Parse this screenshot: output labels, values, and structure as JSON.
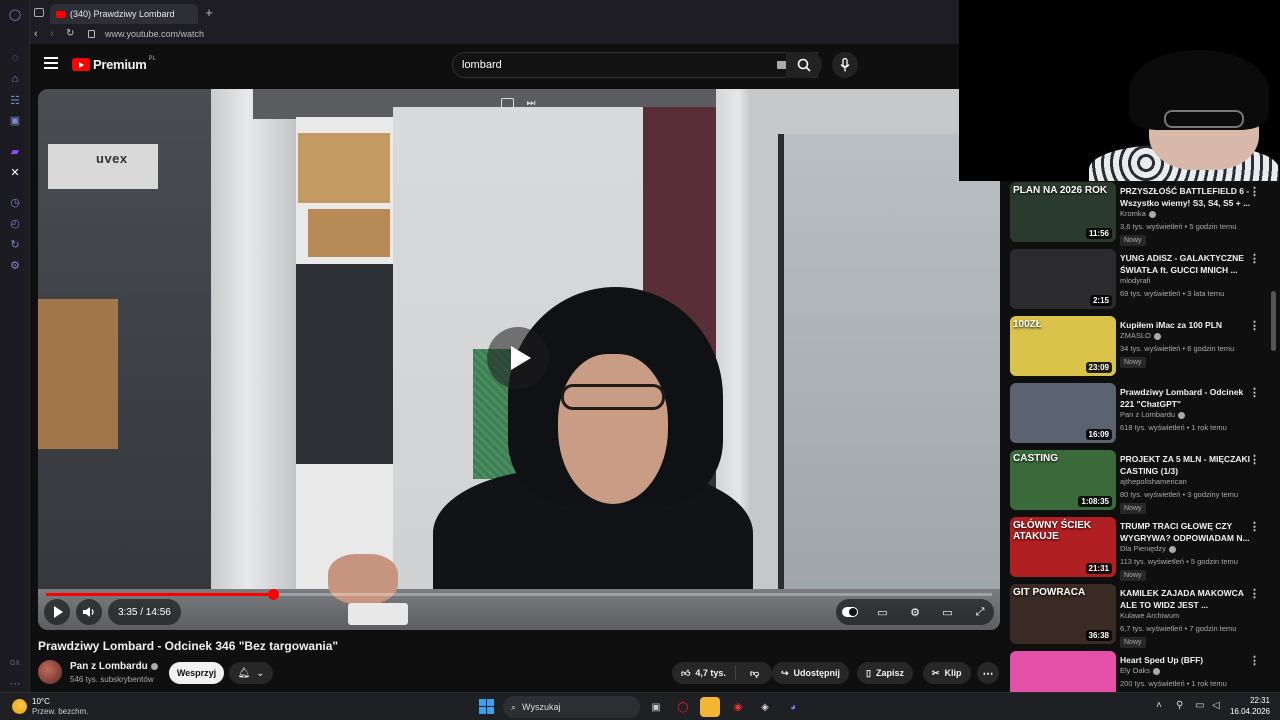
{
  "browser": {
    "tab_title": "(340) Prawdziwy Lombard",
    "new_tab": "+",
    "url": "www.youtube.com/watch"
  },
  "yt_header": {
    "logo_text": "Premium",
    "logo_region": "PL",
    "search_query": "lombard"
  },
  "player": {
    "time": "3:35 / 14:56",
    "progress_fraction": 0.24,
    "scene_text": "uvex"
  },
  "video": {
    "title": "Prawdziwy Lombard - Odcinek 346 \"Bez targowania\"",
    "channel": "Pan z Lombardu",
    "subscribers": "546 tys. subskrybentów",
    "support_label": "Wesprzyj",
    "likes": "4,7 tys.",
    "share_label": "Udostępnij",
    "save_label": "Zapisz",
    "clip_label": "Klip",
    "more_label": "⋯"
  },
  "recommendations": [
    {
      "title": "PRZYSZŁOŚĆ BATTLEFIELD 6 - Wszystko wiemy! S3, S4, S5 + ...",
      "channel": "Kromka",
      "verified": true,
      "meta": "3,6 tys. wyświetleń • 5 godzin temu",
      "duration": "11:56",
      "badge": "Nowy",
      "thumb_text": "PLAN NA 2026 ROK",
      "thumb_color": "#2a3a2c"
    },
    {
      "title": "YUNG ADISZ - GALAKTYCZNE ŚWIATŁA ft. GUCCI MNICH ...",
      "channel": "mlodyrafi",
      "verified": false,
      "meta": "69 tys. wyświetleń • 3 lata temu",
      "duration": "2:15",
      "badge": "",
      "thumb_text": "",
      "thumb_color": "#2b2b2d"
    },
    {
      "title": "Kupiłem iMac za 100 PLN",
      "channel": "ZMASLO",
      "verified": true,
      "meta": "34 tys. wyświetleń • 6 godzin temu",
      "duration": "23:09",
      "badge": "Nowy",
      "thumb_text": "100ZŁ",
      "thumb_color": "#d9c34a"
    },
    {
      "title": "Prawdziwy Lombard - Odcinek 221 \"ChatGPT\"",
      "channel": "Pan z Lombardu",
      "verified": true,
      "meta": "618 tys. wyświetleń • 1 rok temu",
      "duration": "16:09",
      "badge": "",
      "thumb_text": "",
      "thumb_color": "#5a6470"
    },
    {
      "title": "PROJEKT ZA 5 MLN - MIĘCZAKI CASTING (1/3)",
      "channel": "ajthepolishamerican",
      "verified": false,
      "meta": "80 tys. wyświetleń • 3 godziny temu",
      "duration": "1:08:35",
      "badge": "Nowy",
      "thumb_text": "CASTING",
      "thumb_color": "#3b6a3a"
    },
    {
      "title": "TRUMP TRACI GŁOWĘ CZY WYGRYWA? ODPOWIADAM N...",
      "channel": "Dla Pieniędzy",
      "verified": true,
      "meta": "113 tys. wyświetleń • 5 godzin temu",
      "duration": "21:31",
      "badge": "Nowy",
      "thumb_text": "GŁÓWNY ŚCIEK ATAKUJE",
      "thumb_color": "#b01f22"
    },
    {
      "title": "KAMILEK ZAJADA MAKOWCA ALE TO WIDZ JEST ...",
      "channel": "Kulawe Archiwum",
      "verified": false,
      "meta": "6,7 tys. wyświetleń • 7 godzin temu",
      "duration": "36:38",
      "badge": "Nowy",
      "thumb_text": "GIT POWRACA",
      "thumb_color": "#3a2a24"
    },
    {
      "title": "Heart Sped Up (BFF)",
      "channel": "Ely Oaks",
      "verified": true,
      "meta": "200 tys. wyświetleń • 1 rok temu",
      "duration": "",
      "badge": "",
      "thumb_text": "",
      "thumb_color": "#e44fa8"
    }
  ],
  "taskbar": {
    "temperature": "10°C",
    "weather": "Przew. bezchm.",
    "search_label": "Wyszukaj",
    "time": "22:31",
    "date": "16.04.2026"
  }
}
